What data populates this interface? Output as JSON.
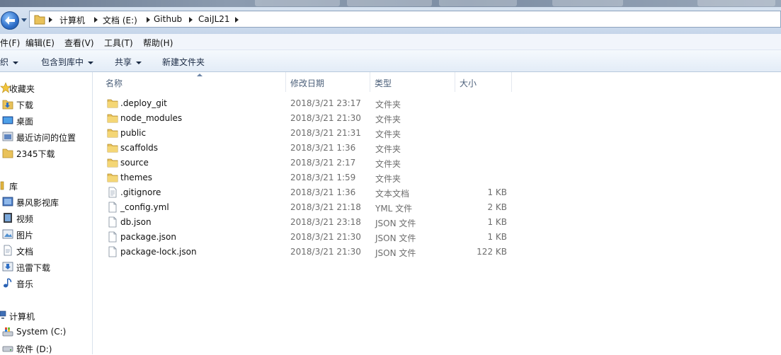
{
  "address": {
    "crumbs": [
      "计算机",
      "文档 (E:)",
      "Github",
      "CaiJL21"
    ]
  },
  "menu": [
    "件(F)",
    "编辑(E)",
    "查看(V)",
    "工具(T)",
    "帮助(H)"
  ],
  "toolbar": {
    "organize": "织",
    "include_library": "包含到库中",
    "share": "共享",
    "new_folder": "新建文件夹"
  },
  "nav": {
    "favorites": "收藏夹",
    "downloads": "下载",
    "desktop": "桌面",
    "recent": "最近访问的位置",
    "dl2345": "2345下载",
    "libraries": "库",
    "baofeng": "暴风影视库",
    "videos": "视频",
    "pictures": "图片",
    "documents": "文档",
    "xunlei": "迅雷下载",
    "music": "音乐",
    "computer": "计算机",
    "system": "System (C:)",
    "software": "软件 (D:)"
  },
  "columns": {
    "name": "名称",
    "date": "修改日期",
    "type": "类型",
    "size": "大小"
  },
  "files": [
    {
      "name": ".deploy_git",
      "date": "2018/3/21 23:17",
      "type": "文件夹",
      "size": "",
      "icon": "folder-icon"
    },
    {
      "name": "node_modules",
      "date": "2018/3/21 21:30",
      "type": "文件夹",
      "size": "",
      "icon": "folder-icon"
    },
    {
      "name": "public",
      "date": "2018/3/21 21:31",
      "type": "文件夹",
      "size": "",
      "icon": "folder-icon"
    },
    {
      "name": "scaffolds",
      "date": "2018/3/21 1:36",
      "type": "文件夹",
      "size": "",
      "icon": "folder-icon"
    },
    {
      "name": "source",
      "date": "2018/3/21 2:17",
      "type": "文件夹",
      "size": "",
      "icon": "folder-icon"
    },
    {
      "name": "themes",
      "date": "2018/3/21 1:59",
      "type": "文件夹",
      "size": "",
      "icon": "folder-icon"
    },
    {
      "name": ".gitignore",
      "date": "2018/3/21 1:36",
      "type": "文本文档",
      "size": "1 KB",
      "icon": "text-file-icon"
    },
    {
      "name": "_config.yml",
      "date": "2018/3/21 21:18",
      "type": "YML 文件",
      "size": "2 KB",
      "icon": "file-icon"
    },
    {
      "name": "db.json",
      "date": "2018/3/21 23:18",
      "type": "JSON 文件",
      "size": "1 KB",
      "icon": "file-icon"
    },
    {
      "name": "package.json",
      "date": "2018/3/21 21:30",
      "type": "JSON 文件",
      "size": "1 KB",
      "icon": "file-icon"
    },
    {
      "name": "package-lock.json",
      "date": "2018/3/21 21:30",
      "type": "JSON 文件",
      "size": "122 KB",
      "icon": "file-icon"
    }
  ]
}
